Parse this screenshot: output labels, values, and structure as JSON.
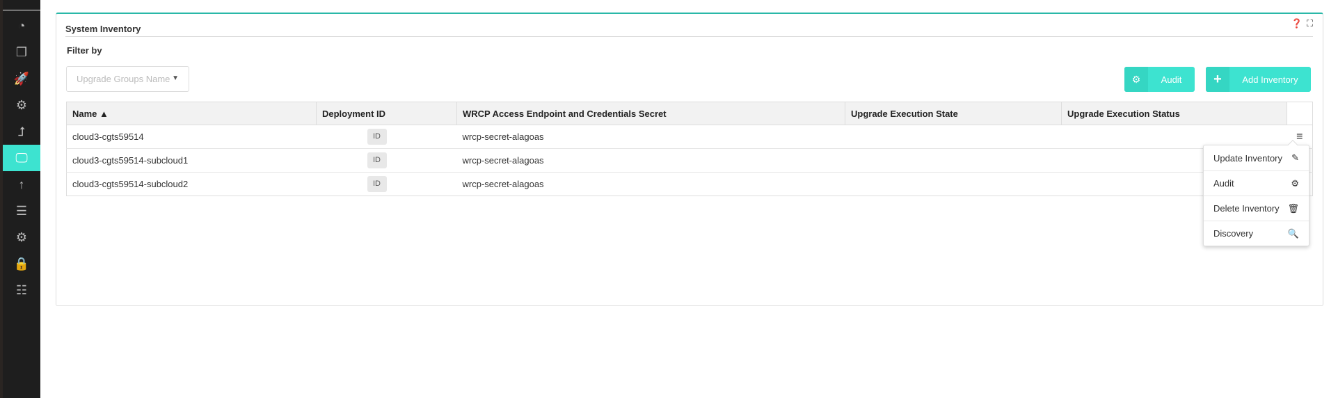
{
  "sidebar": {
    "items": [
      {
        "icon": "dashboard-icon",
        "glyph": "◔"
      },
      {
        "icon": "copy-icon",
        "glyph": "❐"
      },
      {
        "icon": "rocket-icon",
        "glyph": "🚀"
      },
      {
        "icon": "gears-icon",
        "glyph": "⚙"
      },
      {
        "icon": "level-up-icon",
        "glyph": "⮥"
      },
      {
        "icon": "desktop-icon",
        "glyph": "🖵",
        "active": true
      },
      {
        "icon": "arrow-up-icon",
        "glyph": "↑"
      },
      {
        "icon": "server-icon",
        "glyph": "☰"
      },
      {
        "icon": "gear-icon",
        "glyph": "⚙"
      },
      {
        "icon": "lock-icon",
        "glyph": "🔒"
      },
      {
        "icon": "tasks-icon",
        "glyph": "☷"
      }
    ]
  },
  "card": {
    "title": "System Inventory",
    "help_glyph": "❓",
    "expand_glyph": "⛶"
  },
  "filter": {
    "label": "Filter by",
    "placeholder": "Upgrade Groups Name",
    "caret": "▼"
  },
  "buttons": {
    "audit": {
      "label": "Audit",
      "glyph": "⚙"
    },
    "add": {
      "label": "Add Inventory",
      "glyph": "+"
    }
  },
  "table": {
    "headers": [
      "Name ▲",
      "Deployment ID",
      "WRCP Access Endpoint and Credentials Secret",
      "Upgrade Execution State",
      "Upgrade Execution Status"
    ],
    "rows": [
      {
        "name": "cloud3-cgts59514",
        "id": "ID",
        "secret": "wrcp-secret-alagoas",
        "state": "",
        "status": ""
      },
      {
        "name": "cloud3-cgts59514-subcloud1",
        "id": "ID",
        "secret": "wrcp-secret-alagoas",
        "state": "",
        "status": ""
      },
      {
        "name": "cloud3-cgts59514-subcloud2",
        "id": "ID",
        "secret": "wrcp-secret-alagoas",
        "state": "",
        "status": ""
      }
    ],
    "menu_glyph": "≡"
  },
  "menu": {
    "items": [
      {
        "label": "Update Inventory",
        "icon": "edit-icon",
        "glyph": "✎"
      },
      {
        "label": "Audit",
        "icon": "gears-icon",
        "glyph": "⚙"
      },
      {
        "label": "Delete Inventory",
        "icon": "trash-icon",
        "glyph": "🗑"
      },
      {
        "label": "Discovery",
        "icon": "search-icon",
        "glyph": "🔍"
      }
    ]
  },
  "colors": {
    "accent": "#3de3d0",
    "sidebar": "#1e1e1e",
    "card_border_top": "#2ab8a8"
  }
}
